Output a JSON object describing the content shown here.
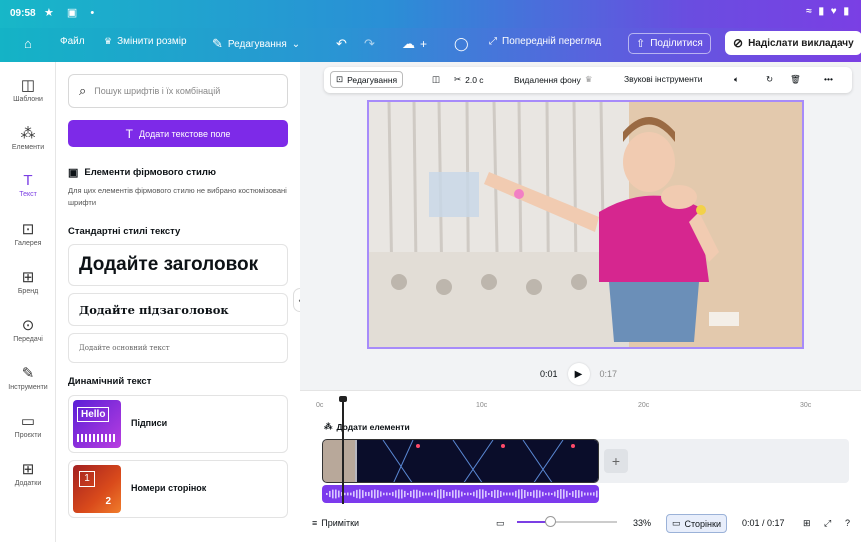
{
  "status_bar": {
    "time": "09:58",
    "left_icons": "★ ▣ •",
    "right_icons": "≈ ▮ ♥ ▮"
  },
  "toolbar": {
    "home_icon": "home-icon",
    "file": "Файл",
    "resize": "Змінити розмір",
    "editing": "Редагування",
    "preview": "Попередній перегляд",
    "share": "Поділитися",
    "publish": "Надіслати викладачу"
  },
  "rail": {
    "items": [
      {
        "label": "Шаблони",
        "icon": "templates-icon",
        "glyph": "◫"
      },
      {
        "label": "Елементи",
        "icon": "elements-icon",
        "glyph": "⁂"
      },
      {
        "label": "Текст",
        "icon": "text-icon",
        "glyph": "T"
      },
      {
        "label": "Галерея",
        "icon": "gallery-icon",
        "glyph": "⊡"
      },
      {
        "label": "Бренд",
        "icon": "brand-icon",
        "glyph": "⊞"
      },
      {
        "label": "Передачі",
        "icon": "uploads-icon",
        "glyph": "⊙"
      },
      {
        "label": "Інструменти",
        "icon": "tools-icon",
        "glyph": "✎"
      },
      {
        "label": "Проєкти",
        "icon": "projects-icon",
        "glyph": "▭"
      },
      {
        "label": "Додатки",
        "icon": "apps-icon",
        "glyph": "⊞"
      }
    ]
  },
  "panel": {
    "search_placeholder": "Пошук шрифтів і їх комбінацій",
    "add_text_button": "Додати текстове поле",
    "brand_title": "Елементи фірмового стилю",
    "brand_desc": "Для цих елементів фірмового стилю не вибрано костюмізовані шрифти",
    "standard_title": "Стандартні стилі тексту",
    "heading": "Додайте заголовок",
    "subheading": "Додайте підзаголовок",
    "body": "Додайте основний текст",
    "dynamic_title": "Динамічний текст",
    "captions_label": "Підписи",
    "captions_thumb": "Hello",
    "page_numbers_label": "Номери сторінок",
    "page_numbers_thumb_a": "1",
    "page_numbers_thumb_b": "2"
  },
  "context_bar": {
    "edit": "Редагування",
    "duration": "2.0 с",
    "remove_bg": "Видалення фону",
    "audio_tools": "Звукові інструменти"
  },
  "playback": {
    "current": "0:01",
    "total": "0:17"
  },
  "timeline": {
    "ticks": [
      "0с",
      "10с",
      "20с",
      "30с"
    ],
    "add_elements": "Додати елементи"
  },
  "bottom_bar": {
    "notes": "Примітки",
    "zoom_percent": "33%",
    "zoom_value": 0.33,
    "pages": "Сторінки",
    "time": "0:01 / 0:17"
  }
}
